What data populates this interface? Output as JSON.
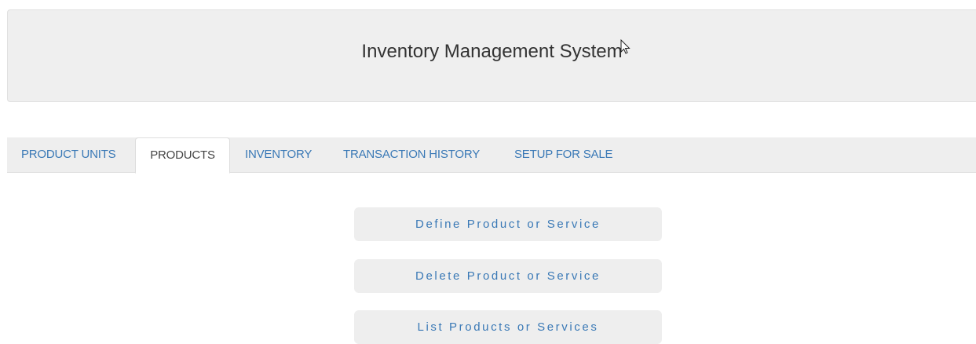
{
  "header": {
    "title": "Inventory Management System"
  },
  "tabs": [
    {
      "label": "PRODUCT UNITS",
      "active": false
    },
    {
      "label": "PRODUCTS",
      "active": true
    },
    {
      "label": "INVENTORY",
      "active": false
    },
    {
      "label": "TRANSACTION HISTORY",
      "active": false
    },
    {
      "label": "SETUP FOR SALE",
      "active": false
    }
  ],
  "actions": {
    "define": "Define Product or Service",
    "delete": "Delete Product or Service",
    "list": "List Products or Services"
  },
  "colors": {
    "link": "#3a79b6",
    "panel": "#efefef",
    "active_tab_text": "#444444"
  },
  "icons": {
    "cursor": "mouse-pointer-icon"
  }
}
